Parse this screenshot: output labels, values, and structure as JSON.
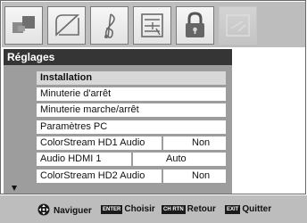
{
  "panel": {
    "title": "Réglages"
  },
  "menu": {
    "items": [
      {
        "label": "Installation",
        "value": null,
        "selected": true
      },
      {
        "label": "Minuterie d'arrêt",
        "value": null
      },
      {
        "label": "Minuterie marche/arrêt",
        "value": null
      },
      {
        "label": "Paramètres PC",
        "value": null
      },
      {
        "label": "ColorStream HD1 Audio",
        "value": "Non"
      },
      {
        "label": "Audio HDMI 1",
        "value": "Auto"
      },
      {
        "label": "ColorStream HD2 Audio",
        "value": "Non"
      }
    ]
  },
  "tabs": [
    {
      "icon": "picture-icon"
    },
    {
      "icon": "sound-icon"
    },
    {
      "icon": "music-note-icon"
    },
    {
      "icon": "settings-list-icon"
    },
    {
      "icon": "lock-icon"
    },
    {
      "icon": "setup-icon",
      "active": true
    }
  ],
  "footer": {
    "navigate_label": "Naviguer",
    "enter_key": "ENTER",
    "choose_label": "Choisir",
    "ch_rtn_key": "CH RTN",
    "back_label": "Retour",
    "exit_key": "EXIT",
    "exit_label": "Quitter"
  },
  "colors": {
    "title_bar": "#353535",
    "menu_background": "#9d9d9d",
    "strip_background": "#bdbdbd",
    "selected_row": "#d8d8d8"
  }
}
